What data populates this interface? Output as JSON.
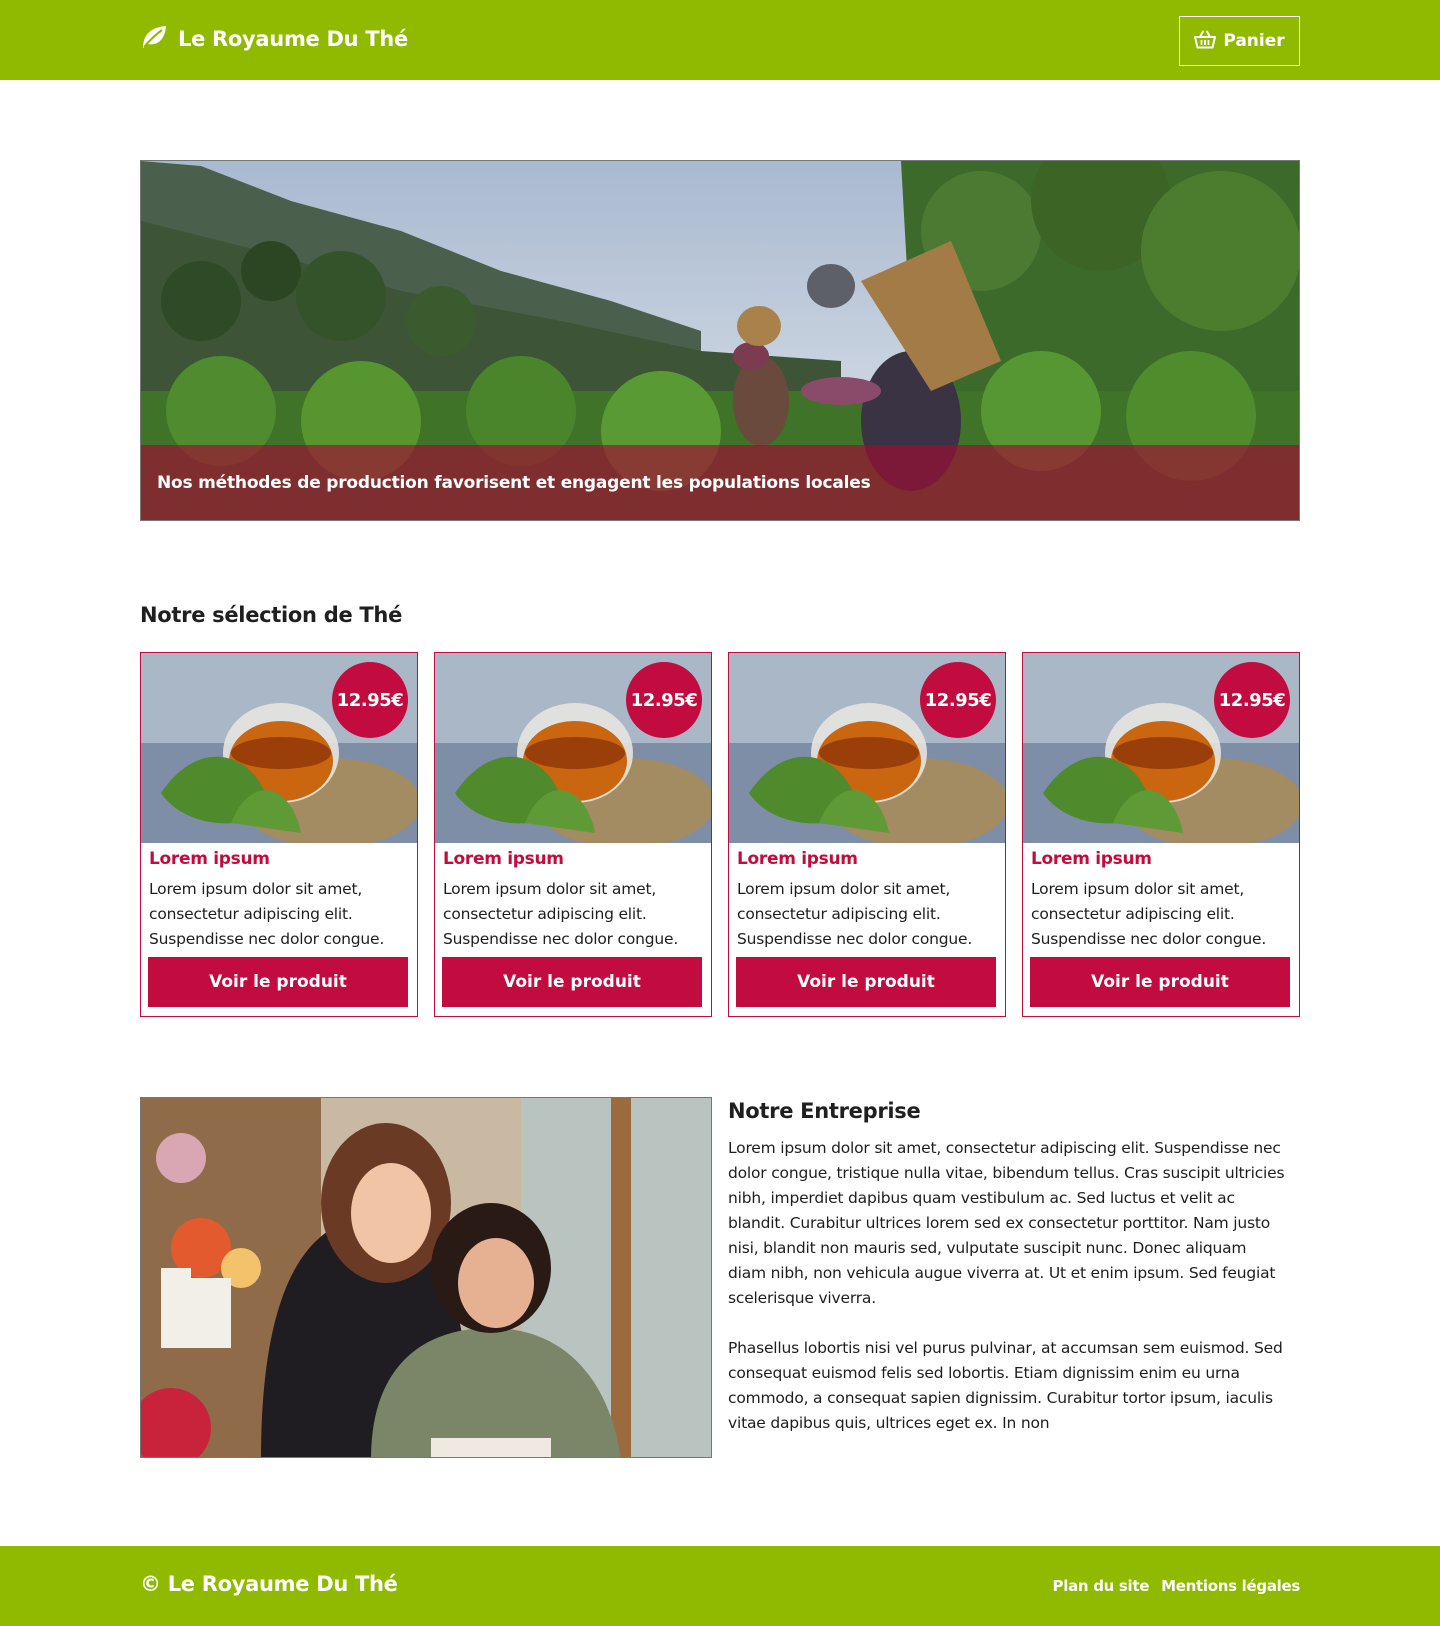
{
  "header": {
    "brand_icon": "leaf-icon",
    "brand_name": "Le Royaume Du Thé",
    "cart_icon": "basket-icon",
    "cart_label": "Panier"
  },
  "hero": {
    "caption": "Nos méthodes de production favorisent et engagent les populations locales"
  },
  "selection": {
    "title": "Notre sélection de Thé",
    "products": [
      {
        "price": "12.95€",
        "name": "Lorem ipsum",
        "description": "Lorem ipsum dolor sit amet, consectetur adipiscing elit. Suspendisse nec dolor congue.",
        "button": "Voir le produit"
      },
      {
        "price": "12.95€",
        "name": "Lorem ipsum",
        "description": "Lorem ipsum dolor sit amet, consectetur adipiscing elit. Suspendisse nec dolor congue.",
        "button": "Voir le produit"
      },
      {
        "price": "12.95€",
        "name": "Lorem ipsum",
        "description": "Lorem ipsum dolor sit amet, consectetur adipiscing elit. Suspendisse nec dolor congue.",
        "button": "Voir le produit"
      },
      {
        "price": "12.95€",
        "name": "Lorem ipsum",
        "description": "Lorem ipsum dolor sit amet, consectetur adipiscing elit. Suspendisse nec dolor congue.",
        "button": "Voir le produit"
      }
    ]
  },
  "company": {
    "title": "Notre Entreprise",
    "paragraph_1": "Lorem ipsum dolor sit amet, consectetur adipiscing elit. Suspendisse nec dolor congue, tristique nulla vitae, bibendum tellus. Cras suscipit ultricies nibh, imperdiet dapibus quam vestibulum ac. Sed luctus et velit ac blandit. Curabitur ultrices lorem sed ex consectetur porttitor. Nam justo nisi, blandit non mauris sed, vulputate suscipit nunc. Donec aliquam diam nibh, non vehicula augue viverra at. Ut et enim ipsum. Sed feugiat scelerisque viverra.",
    "paragraph_2": "Phasellus lobortis nisi vel purus pulvinar, at accumsan sem euismod. Sed consequat euismod felis sed lobortis. Etiam dignissim enim eu urna commodo, a consequat sapien dignissim. Curabitur tortor ipsum, iaculis vitae dapibus quis, ultrices eget ex. In non"
  },
  "footer": {
    "brand": "© Le Royaume Du Thé",
    "links": [
      "Plan du site",
      "Mentions légales"
    ]
  },
  "colors": {
    "brand_green": "#8fba00",
    "accent_red": "#c20b3e",
    "text_dark": "#1e1e1e"
  }
}
